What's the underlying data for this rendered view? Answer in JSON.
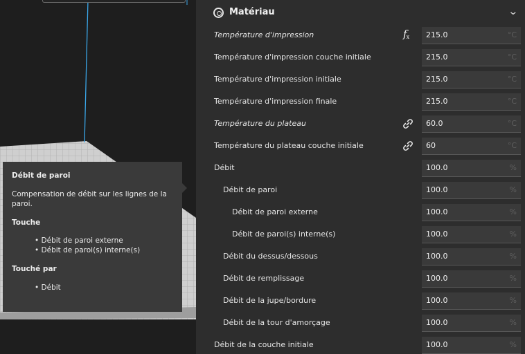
{
  "tooltip": {
    "title": "Débit de paroi",
    "description": "Compensation de débit sur les lignes de la paroi.",
    "affects_heading": "Touche",
    "affects": [
      "Débit de paroi externe",
      "Débit de paroi(s) interne(s)"
    ],
    "affected_by_heading": "Touché par",
    "affected_by": [
      "Débit"
    ]
  },
  "panel": {
    "section_title": "Matériau",
    "section_icon": "material-spool-icon",
    "collapse_icon": "chevron-down-icon",
    "settings": [
      {
        "label": "Température d'impression",
        "italic": true,
        "value": "215.0",
        "unit": "°C",
        "indent": 0,
        "icon": "function-fx-icon"
      },
      {
        "label": "Température d'impression couche initiale",
        "italic": false,
        "value": "215.0",
        "unit": "°C",
        "indent": 0
      },
      {
        "label": "Température d'impression initiale",
        "italic": false,
        "value": "215.0",
        "unit": "°C",
        "indent": 0
      },
      {
        "label": "Température d'impression finale",
        "italic": false,
        "value": "215.0",
        "unit": "°C",
        "indent": 0
      },
      {
        "label": "Température du plateau",
        "italic": true,
        "value": "60.0",
        "unit": "°C",
        "indent": 0,
        "icon": "link-icon"
      },
      {
        "label": "Température du plateau couche initiale",
        "italic": false,
        "value": "60",
        "unit": "°C",
        "indent": 0,
        "icon": "link-icon"
      },
      {
        "label": "Débit",
        "italic": false,
        "value": "100.0",
        "unit": "%",
        "indent": 0
      },
      {
        "label": "Débit de paroi",
        "italic": false,
        "value": "100.0",
        "unit": "%",
        "indent": 1
      },
      {
        "label": "Débit de paroi externe",
        "italic": false,
        "value": "100.0",
        "unit": "%",
        "indent": 2
      },
      {
        "label": "Débit de paroi(s) interne(s)",
        "italic": false,
        "value": "100.0",
        "unit": "%",
        "indent": 2
      },
      {
        "label": "Débit du dessus/dessous",
        "italic": false,
        "value": "100.0",
        "unit": "%",
        "indent": 1
      },
      {
        "label": "Débit de remplissage",
        "italic": false,
        "value": "100.0",
        "unit": "%",
        "indent": 1
      },
      {
        "label": "Débit de la jupe/bordure",
        "italic": false,
        "value": "100.0",
        "unit": "%",
        "indent": 1
      },
      {
        "label": "Débit de la tour d'amorçage",
        "italic": false,
        "value": "100.0",
        "unit": "%",
        "indent": 1
      },
      {
        "label": "Débit de la couche initiale",
        "italic": false,
        "value": "100.0",
        "unit": "%",
        "indent": 0
      }
    ]
  }
}
